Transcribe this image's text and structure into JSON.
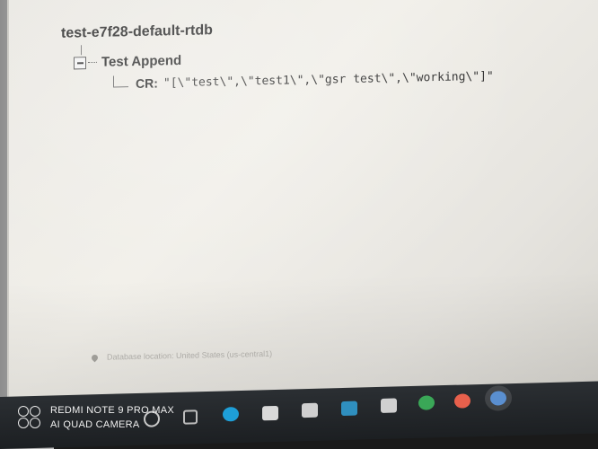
{
  "database": {
    "name": "test-e7f28-default-rtdb"
  },
  "tree": {
    "node": {
      "name": "Test Append",
      "toggle_icon": "collapse-minus-icon"
    },
    "child": {
      "key": "CR:",
      "value": "\"[\\\"test\\\",\\\"test1\\\",\\\"gsr test\\\",\\\"working\\\"]\""
    }
  },
  "footer": {
    "location_icon": "location-pin-icon",
    "location_text": "Database location: United States (us-central1)"
  },
  "taskbar": {
    "icons": [
      {
        "name": "search-icon",
        "color": "#c9c9c9"
      },
      {
        "name": "task-view-icon",
        "color": "#bdbdbd"
      },
      {
        "name": "edge-icon",
        "color": "#1e9fd8"
      },
      {
        "name": "mail-icon",
        "color": "#d9d9d9"
      },
      {
        "name": "store-icon",
        "color": "#cfcfcf"
      },
      {
        "name": "app-icon",
        "color": "#2f8fbf"
      },
      {
        "name": "calendar-icon",
        "color": "#d0d0d0"
      },
      {
        "name": "chrome-icon",
        "color": "#3aa757"
      },
      {
        "name": "firefox-icon",
        "color": "#e8604c"
      },
      {
        "name": "chrome-active-icon",
        "color": "#5a8fd0"
      }
    ]
  },
  "watermark": {
    "line1": "REDMI NOTE 9 PRO MAX",
    "line2": "AI QUAD CAMERA"
  }
}
